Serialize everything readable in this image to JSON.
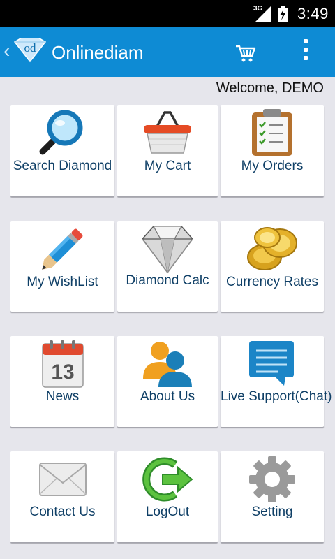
{
  "status_bar": {
    "network": "3G",
    "time": "3:49"
  },
  "action_bar": {
    "title": "Onlinediam",
    "logo_text": "od"
  },
  "welcome": {
    "text": "Welcome,  DEMO"
  },
  "menu": [
    {
      "label": "Search Diamond",
      "icon": "search-icon"
    },
    {
      "label": "My Cart",
      "icon": "basket-icon"
    },
    {
      "label": "My Orders",
      "icon": "clipboard-icon"
    },
    {
      "label": "My WishList",
      "icon": "pencil-icon"
    },
    {
      "label": "Diamond Calc",
      "icon": "diamond-icon"
    },
    {
      "label": "Currency Rates",
      "icon": "coins-icon"
    },
    {
      "label": "News",
      "icon": "calendar-icon",
      "icon_text": "13"
    },
    {
      "label": "About Us",
      "icon": "users-icon"
    },
    {
      "label": "Live Support(Chat)",
      "icon": "chat-bubble-icon"
    },
    {
      "label": "Contact Us",
      "icon": "envelope-icon"
    },
    {
      "label": "LogOut",
      "icon": "logout-icon"
    },
    {
      "label": "Setting",
      "icon": "gear-icon"
    }
  ],
  "colors": {
    "action_bar": "#0e8bd4",
    "label": "#0f3f66",
    "background": "#e6e6ec"
  }
}
